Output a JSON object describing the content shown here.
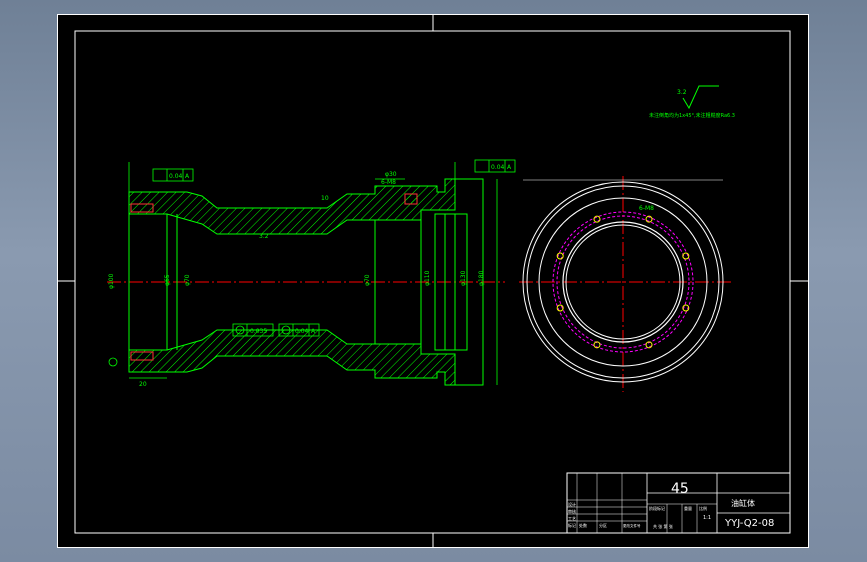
{
  "colors": {
    "background": "#000000",
    "frame": "#ffffff",
    "outline": "#00ff00",
    "centerline": "#ff0000",
    "dimension": "#00ff00",
    "hatch": "#00ff00",
    "bolt_circle": "#ff00ff",
    "bolt_holes": "#ffff00"
  },
  "drawing": {
    "material": "45",
    "drawing_number": "YYJ-Q2-08",
    "part_name": "油缸体",
    "scale": "1:1",
    "tech_note": "未注倒角均为1x45°,未注粗糙度Ra6.3",
    "roughness_symbol": "3.2"
  },
  "dimensions": {
    "left_dia": "φ100",
    "bore_dia": "φ65",
    "mid_dia": "φ70",
    "inner_dia": "φ70",
    "right_dia": "φ110",
    "outer_dia": "φ180",
    "flange_dia": "φ130",
    "groove_width": "φ30",
    "wall": "10",
    "left_len": "20",
    "hole_spec": "6-M8",
    "tol_a": "0.04",
    "tol_b": "0.035",
    "datum": "A",
    "slope": "3.2"
  },
  "title_block": {
    "labels": [
      "标记",
      "处数",
      "分区",
      "更改文件号",
      "签名",
      "年月日"
    ],
    "role_labels": [
      "设计",
      "审核",
      "工艺"
    ],
    "stage_labels": [
      "阶段标记",
      "重量",
      "比例"
    ],
    "sheet_label": "共 张 第 张"
  }
}
